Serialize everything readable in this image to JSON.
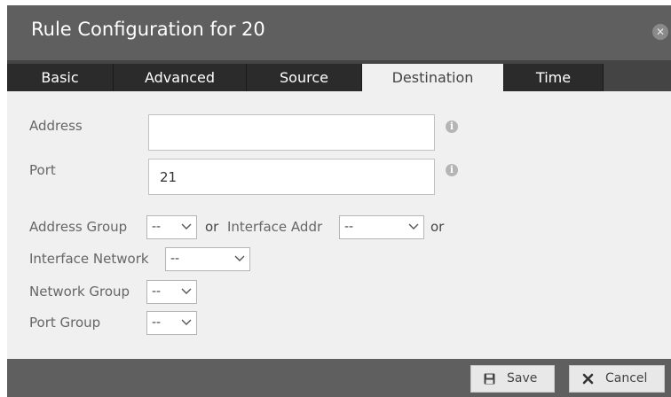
{
  "dialog": {
    "title": "Rule Configuration for 20",
    "close_icon": "close-icon"
  },
  "tabs": [
    {
      "label": "Basic",
      "active": false
    },
    {
      "label": "Advanced",
      "active": false
    },
    {
      "label": "Source",
      "active": false
    },
    {
      "label": "Destination",
      "active": true
    },
    {
      "label": "Time",
      "active": false
    }
  ],
  "form": {
    "address": {
      "label": "Address",
      "value": ""
    },
    "port": {
      "label": "Port",
      "value": "21"
    },
    "address_group": {
      "label": "Address Group",
      "value": "--"
    },
    "or_text": "or",
    "interface_addr": {
      "label": "Interface Addr",
      "value": "--"
    },
    "interface_network": {
      "label": "Interface Network",
      "value": "--"
    },
    "network_group": {
      "label": "Network Group",
      "value": "--"
    },
    "port_group": {
      "label": "Port Group",
      "value": "--"
    },
    "info_icon": "info-icon"
  },
  "footer": {
    "save_label": "Save",
    "cancel_label": "Cancel"
  },
  "colors": {
    "titlebar": "#5f5f5f",
    "tab_bar": "#444444",
    "tab": "#2b2b2b",
    "tab_active": "#f0f0f0",
    "content": "#f0f0f0"
  }
}
